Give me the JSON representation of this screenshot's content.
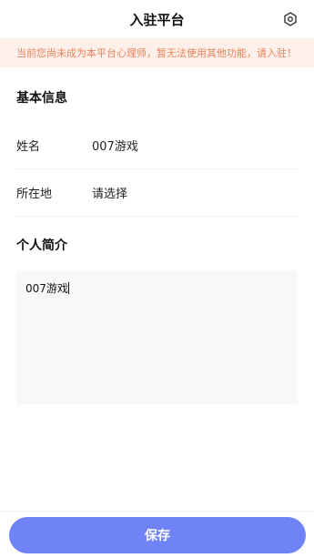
{
  "nav": {
    "title": "入驻平台",
    "settings_icon": "hexagon-gear-icon"
  },
  "notice": {
    "text": "当前您尚未成为本平台心理师，暂无法使用其他功能，请入驻！",
    "color": "#e8835a",
    "background": "#fdf0ea"
  },
  "basic_info": {
    "title": "基本信息",
    "fields": [
      {
        "label": "姓名",
        "value": "007游戏"
      },
      {
        "label": "所在地",
        "value": "请选择"
      }
    ]
  },
  "profile": {
    "title": "个人简介",
    "value": "007游戏"
  },
  "footer": {
    "save_label": "保存",
    "accent": "#6f83f7"
  }
}
